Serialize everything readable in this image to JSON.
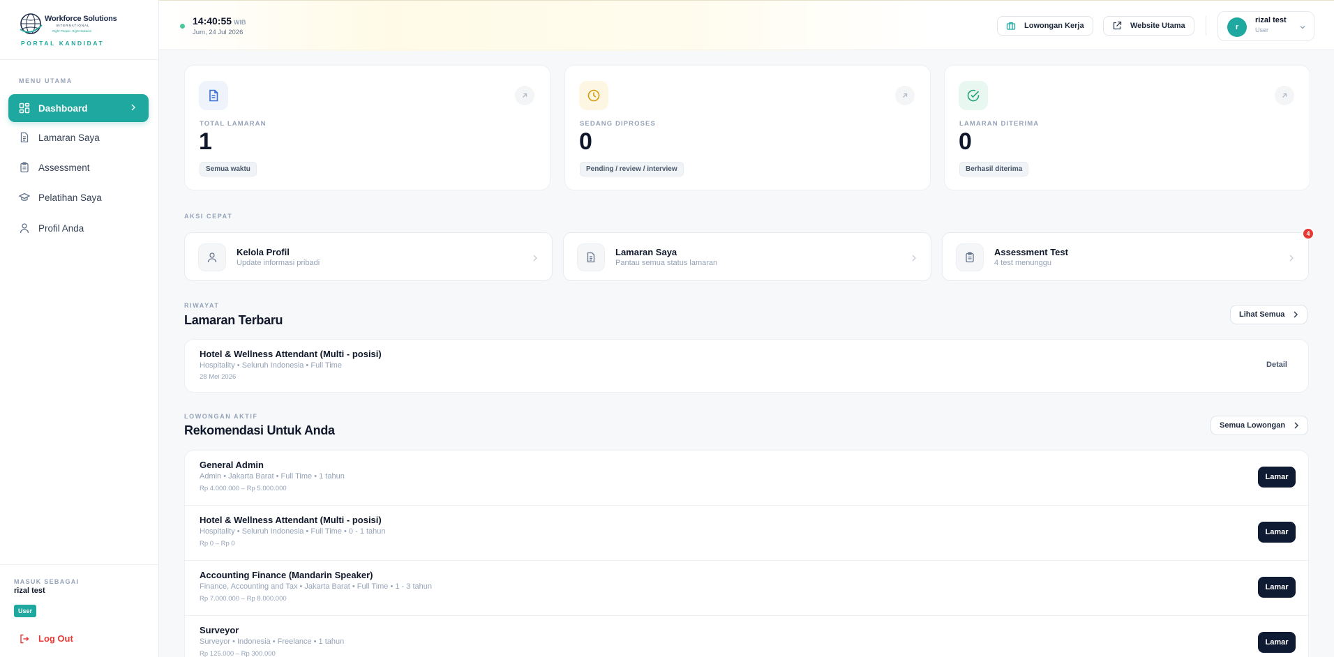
{
  "brand": {
    "logo_name": "Workforce Solutions",
    "logo_sub": "INTERNATIONAL",
    "logo_tag": "Right People, Right Solution",
    "portal_label": "PORTAL KANDIDAT"
  },
  "sidebar": {
    "menu_label": "MENU UTAMA",
    "items": [
      {
        "label": "Dashboard",
        "icon": "dashboard-icon",
        "active": true
      },
      {
        "label": "Lamaran Saya",
        "icon": "document-icon",
        "active": false
      },
      {
        "label": "Assessment",
        "icon": "clipboard-icon",
        "active": false
      },
      {
        "label": "Pelatihan Saya",
        "icon": "graduation-cap-icon",
        "active": false
      },
      {
        "label": "Profil Anda",
        "icon": "user-icon",
        "active": false
      }
    ],
    "signed_in_label": "MASUK SEBAGAI",
    "signed_in_name": "rizal test",
    "role_badge": "User",
    "logout_label": "Log Out"
  },
  "header": {
    "time": "14:40:55",
    "timezone": "WIB",
    "date": "Jum, 24 Jul 2026",
    "jobs_button": "Lowongan Kerja",
    "website_button": "Website Utama",
    "user_initial": "r",
    "user_name": "rizal test",
    "user_role": "User"
  },
  "stats": [
    {
      "label": "TOTAL LAMARAN",
      "value": "1",
      "pill": "Semua waktu",
      "icon": "document-icon",
      "accent": "#3b6fd8",
      "bg": "#eef3fc"
    },
    {
      "label": "SEDANG DIPROSES",
      "value": "0",
      "pill": "Pending / review / interview",
      "icon": "clock-icon",
      "accent": "#d49b0b",
      "bg": "#fdf6e3"
    },
    {
      "label": "LAMARAN DITERIMA",
      "value": "0",
      "pill": "Berhasil diterima",
      "icon": "check-circle-icon",
      "accent": "#1ea37a",
      "bg": "#e9f7f1"
    }
  ],
  "quick_actions": {
    "section_label": "AKSI CEPAT",
    "items": [
      {
        "title": "Kelola Profil",
        "subtitle": "Update informasi pribadi",
        "icon": "user-icon"
      },
      {
        "title": "Lamaran Saya",
        "subtitle": "Pantau semua status lamaran",
        "icon": "document-icon"
      },
      {
        "title": "Assessment Test",
        "subtitle": "4 test menunggu",
        "icon": "clipboard-icon",
        "badge": "4"
      }
    ]
  },
  "recent": {
    "section_label": "RIWAYAT",
    "title": "Lamaran Terbaru",
    "see_all": "Lihat Semua",
    "items": [
      {
        "title": "Hotel & Wellness Attendant (Multi - posisi)",
        "meta": "Hospitality • Seluruh Indonesia • Full Time",
        "date": "28 Mei 2026",
        "action": "Detail"
      }
    ]
  },
  "recommendations": {
    "section_label": "LOWONGAN AKTIF",
    "title": "Rekomendasi Untuk Anda",
    "see_all": "Semua Lowongan",
    "apply_label": "Lamar",
    "jobs": [
      {
        "title": "General Admin",
        "meta": "Admin • Jakarta Barat • Full Time • 1 tahun",
        "salary": "Rp 4.000.000 – Rp 5.000.000"
      },
      {
        "title": "Hotel & Wellness Attendant (Multi - posisi)",
        "meta": "Hospitality • Seluruh Indonesia • Full Time • 0 - 1 tahun",
        "salary": "Rp 0 – Rp 0"
      },
      {
        "title": "Accounting Finance (Mandarin Speaker)",
        "meta": "Finance, Accounting and Tax • Jakarta Barat • Full Time • 1 - 3 tahun",
        "salary": "Rp 7.000.000 – Rp 8.000.000"
      },
      {
        "title": "Surveyor",
        "meta": "Surveyor • Indonesia • Freelance • 1 tahun",
        "salary": "Rp 125.000 – Rp 300.000"
      }
    ]
  }
}
